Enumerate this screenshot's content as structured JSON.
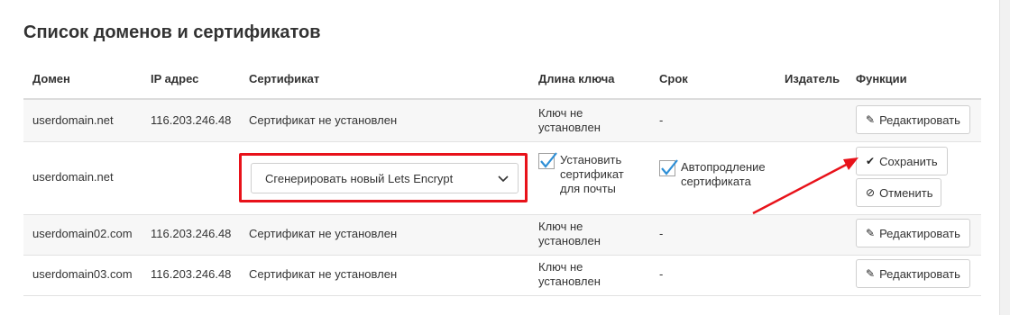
{
  "title": "Список доменов и сертификатов",
  "columns": {
    "domain": "Домен",
    "ip": "IP адрес",
    "cert": "Сертификат",
    "keylen": "Длина ключа",
    "term": "Срок",
    "issuer": "Издатель",
    "functions": "Функции"
  },
  "rows": [
    {
      "domain": "userdomain.net",
      "ip": "116.203.246.48",
      "cert": "Сертификат не установлен",
      "keylen_1": "Ключ не",
      "keylen_2": "установлен",
      "term": "-",
      "edit_label": "Редактировать"
    },
    {
      "domain": "userdomain.net"
    },
    {
      "domain": "userdomain02.com",
      "ip": "116.203.246.48",
      "cert": "Сертификат не установлен",
      "keylen_1": "Ключ не",
      "keylen_2": "установлен",
      "term": "-",
      "edit_label": "Редактировать"
    },
    {
      "domain": "userdomain03.com",
      "ip": "116.203.246.48",
      "cert": "Сертификат не установлен",
      "keylen_1": "Ключ не",
      "keylen_2": "установлен",
      "term": "-",
      "edit_label": "Редактировать"
    }
  ],
  "edit_row": {
    "cert_select_value": "Сгенерировать новый Lets Encrypt",
    "mail_checkbox": {
      "checked": true,
      "line1": "Установить",
      "line2": "сертификат",
      "line3": "для почты"
    },
    "autorenew_checkbox": {
      "checked": true,
      "line1": "Автопродление",
      "line2": "сертификата"
    },
    "save_label": "Сохранить",
    "cancel_label": "Отменить"
  },
  "annotation_color": "#e8121a",
  "icons": {
    "edit": "pencil-icon",
    "save": "check-icon",
    "cancel": "ban-icon",
    "select": "chevron-down-icon",
    "checkbox": "checkmark-icon"
  }
}
